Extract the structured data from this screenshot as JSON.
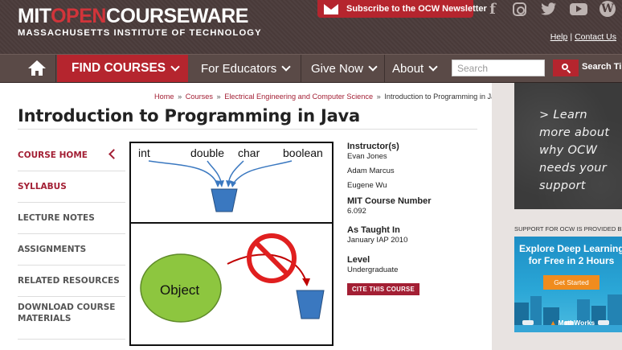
{
  "header": {
    "logo_part1": "MIT",
    "logo_part2": "OPEN",
    "logo_part3": "COURSEWARE",
    "logo_subtitle": "MASSACHUSETTS INSTITUTE OF TECHNOLOGY",
    "newsletter_label": "Subscribe to the OCW Newsletter",
    "social_icons": [
      "facebook-icon",
      "instagram-icon",
      "twitter-icon",
      "youtube-icon",
      "wordpress-icon"
    ],
    "facebook_glyph": "f",
    "wordpress_glyph": "W",
    "help_label": "Help",
    "help_sep": "|",
    "contact_label": "Contact Us",
    "brand_color": "#a31f34"
  },
  "nav": {
    "home_icon": "home-icon",
    "find_courses": "FIND COURSES",
    "for_educators": "For Educators",
    "give_now": "Give Now",
    "about": "About",
    "search_placeholder": "Search",
    "search_icon": "search-icon",
    "search_tips": "Search Tips"
  },
  "breadcrumb": {
    "items": [
      "Home",
      "Courses",
      "Electrical Engineering and Computer Science"
    ],
    "current": "Introduction to Programming in Java",
    "sep": "»"
  },
  "course": {
    "title": "Introduction to Programming in Java",
    "nav": [
      "COURSE HOME",
      "SYLLABUS",
      "LECTURE NOTES",
      "ASSIGNMENTS",
      "RELATED RESOURCES",
      "DOWNLOAD COURSE MATERIALS"
    ],
    "image_words": {
      "int": "int",
      "double": "double",
      "char": "char",
      "boolean": "boolean",
      "object": "Object"
    },
    "info": {
      "instructors_heading": "Instructor(s)",
      "instructors": [
        "Evan Jones",
        "Adam Marcus",
        "Eugene Wu"
      ],
      "number_heading": "MIT Course Number",
      "number": "6.092",
      "taught_heading": "As Taught In",
      "taught": "January IAP 2010",
      "level_heading": "Level",
      "level": "Undergraduate",
      "cite_label": "CITE THIS COURSE"
    }
  },
  "sidebar": {
    "chalk_ad_text": "> Learn more about why OCW needs your support",
    "sponsor_label": "SUPPORT FOR OCW IS PROVIDED BY:",
    "mw_headline_1": "Explore Deep Learning",
    "mw_headline_2": "for Free in 2 Hours",
    "mw_button": "Get Started",
    "mw_logo_mark": "▲",
    "mw_logo": "MathWorks"
  }
}
